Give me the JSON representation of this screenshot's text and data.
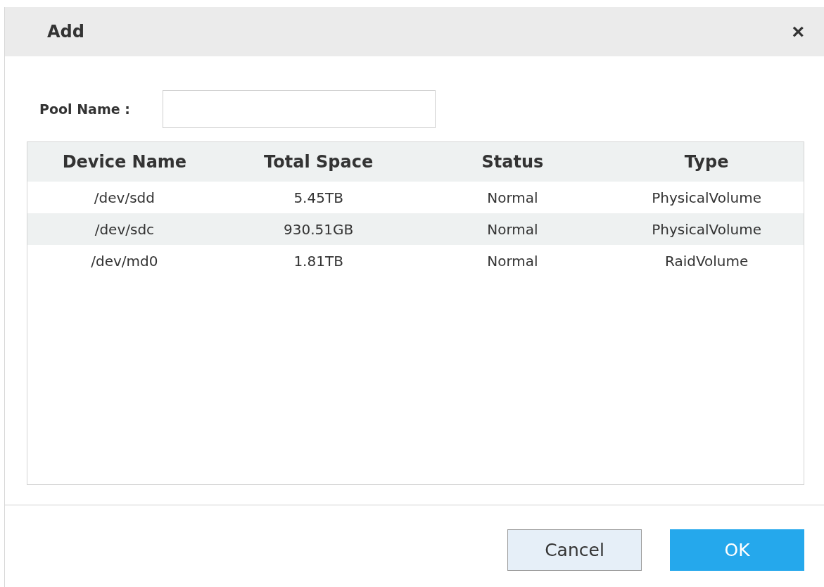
{
  "dialog": {
    "title": "Add",
    "close": "×"
  },
  "pool_name": {
    "label": "Pool Name :"
  },
  "table": {
    "columns": [
      "Device Name",
      "Total Space",
      "Status",
      "Type"
    ],
    "rows": [
      [
        "/dev/sdd",
        "5.45TB",
        "Normal",
        "PhysicalVolume"
      ],
      [
        "/dev/sdc",
        "930.51GB",
        "Normal",
        "PhysicalVolume"
      ],
      [
        "/dev/md0",
        "1.81TB",
        "Normal",
        "RaidVolume"
      ]
    ]
  },
  "buttons": [
    {
      "label": "Cancel",
      "kind": "secondary"
    },
    {
      "label": "OK",
      "kind": "primary"
    }
  ]
}
